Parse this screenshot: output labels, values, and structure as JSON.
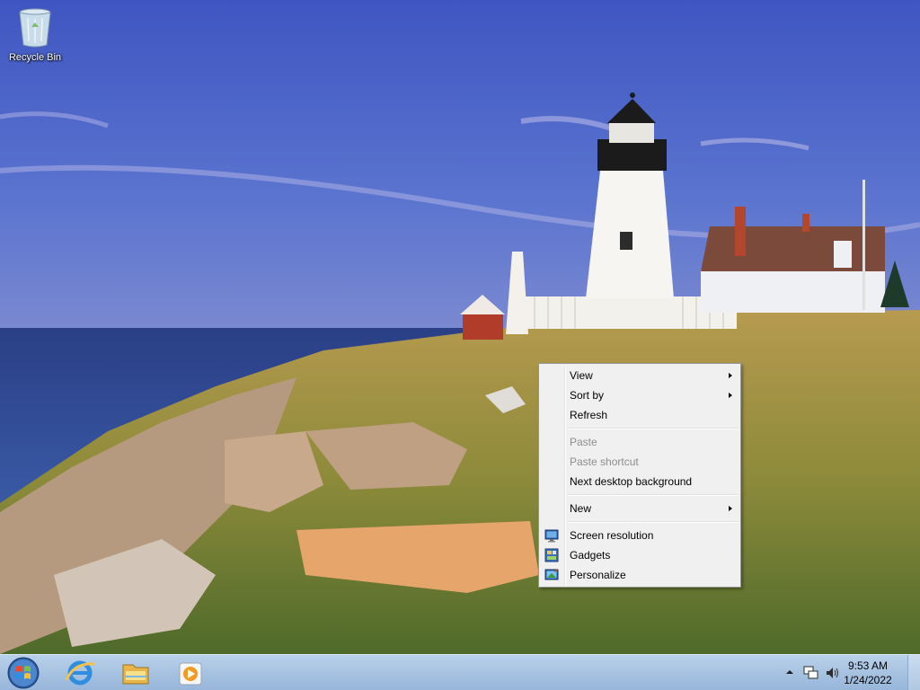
{
  "desktop": {
    "icons": [
      {
        "label": "Recycle Bin",
        "icon": "recycle-bin-icon"
      }
    ]
  },
  "context_menu": {
    "items": [
      {
        "label": "View",
        "submenu": true,
        "enabled": true
      },
      {
        "label": "Sort by",
        "submenu": true,
        "enabled": true
      },
      {
        "label": "Refresh",
        "submenu": false,
        "enabled": true
      },
      {
        "label": "Paste",
        "submenu": false,
        "enabled": false
      },
      {
        "label": "Paste shortcut",
        "submenu": false,
        "enabled": false
      },
      {
        "label": "Next desktop background",
        "submenu": false,
        "enabled": true
      },
      {
        "label": "New",
        "submenu": true,
        "enabled": true
      },
      {
        "label": "Screen resolution",
        "icon": "screen-resolution-icon",
        "enabled": true
      },
      {
        "label": "Gadgets",
        "icon": "gadgets-icon",
        "enabled": true
      },
      {
        "label": "Personalize",
        "icon": "personalize-icon",
        "enabled": true
      }
    ]
  },
  "taskbar": {
    "pinned": [
      {
        "icon": "internet-explorer-icon"
      },
      {
        "icon": "windows-explorer-icon"
      },
      {
        "icon": "media-player-icon"
      }
    ],
    "tray": {
      "icons": [
        "show-hidden-icons-arrow-icon",
        "network-icon",
        "volume-icon"
      ],
      "time": "9:53 AM",
      "date": "1/24/2022"
    }
  },
  "colors": {
    "taskbar": "#a9c4e2",
    "menu_background": "#f0f0f0",
    "menu_border": "#979797",
    "disabled_text": "#8d8d8d"
  }
}
